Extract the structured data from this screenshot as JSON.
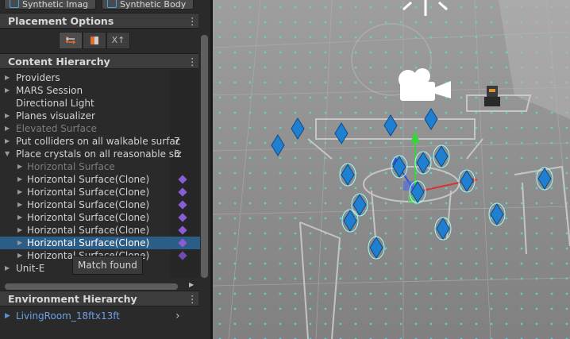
{
  "top_buttons": [
    {
      "label": "Synthetic Imag"
    },
    {
      "label": "Synthetic Body"
    }
  ],
  "placement_options": {
    "title": "Placement Options",
    "tools": [
      "transform-swap",
      "box",
      "X↑"
    ]
  },
  "content_hierarchy": {
    "title": "Content Hierarchy",
    "items": [
      {
        "label": "Providers",
        "count": "",
        "state": "normal"
      },
      {
        "label": "MARS Session",
        "count": "",
        "state": "normal"
      },
      {
        "label": "Directional Light",
        "count": "",
        "state": "normal"
      },
      {
        "label": "Planes visualizer",
        "count": "",
        "state": "normal"
      },
      {
        "label": "Elevated Surface",
        "count": "",
        "state": "disabled"
      },
      {
        "label": "Put colliders on all walkable surfac",
        "count": "7",
        "state": "normal"
      },
      {
        "label": "Place crystals on all reasonable siz",
        "count": "6",
        "state": "normal"
      },
      {
        "label": "Horizontal Surface",
        "count": "",
        "state": "disabled"
      },
      {
        "label": "Horizontal Surface(Clone)",
        "count": "",
        "state": "normal"
      },
      {
        "label": "Horizontal Surface(Clone)",
        "count": "",
        "state": "normal"
      },
      {
        "label": "Horizontal Surface(Clone)",
        "count": "",
        "state": "normal"
      },
      {
        "label": "Horizontal Surface(Clone)",
        "count": "",
        "state": "normal"
      },
      {
        "label": "Horizontal Surface(Clone)",
        "count": "",
        "state": "normal"
      },
      {
        "label": "Horizontal Surface(Clone)",
        "count": "",
        "state": "selected"
      },
      {
        "label": "Horizontal Surface(Clone)",
        "count": "",
        "state": "normal"
      },
      {
        "label": "Unit-E",
        "count": "",
        "state": "normal"
      }
    ],
    "tooltip": "Match found"
  },
  "environment_hierarchy": {
    "title": "Environment Hierarchy",
    "item": "LivingRoom_18ftx13ft"
  },
  "colors": {
    "selection": "#2c5d87",
    "match_icon": "#8a5cd6",
    "link_blue": "#6ea0e8",
    "crystal": "#1f7fd0",
    "axis_y": "#3cd23c",
    "axis_x": "#e03030",
    "axis_z": "#3050e0"
  },
  "scene": {
    "icons": [
      "sun-icon",
      "camera-icon",
      "unit-e-robot"
    ]
  }
}
